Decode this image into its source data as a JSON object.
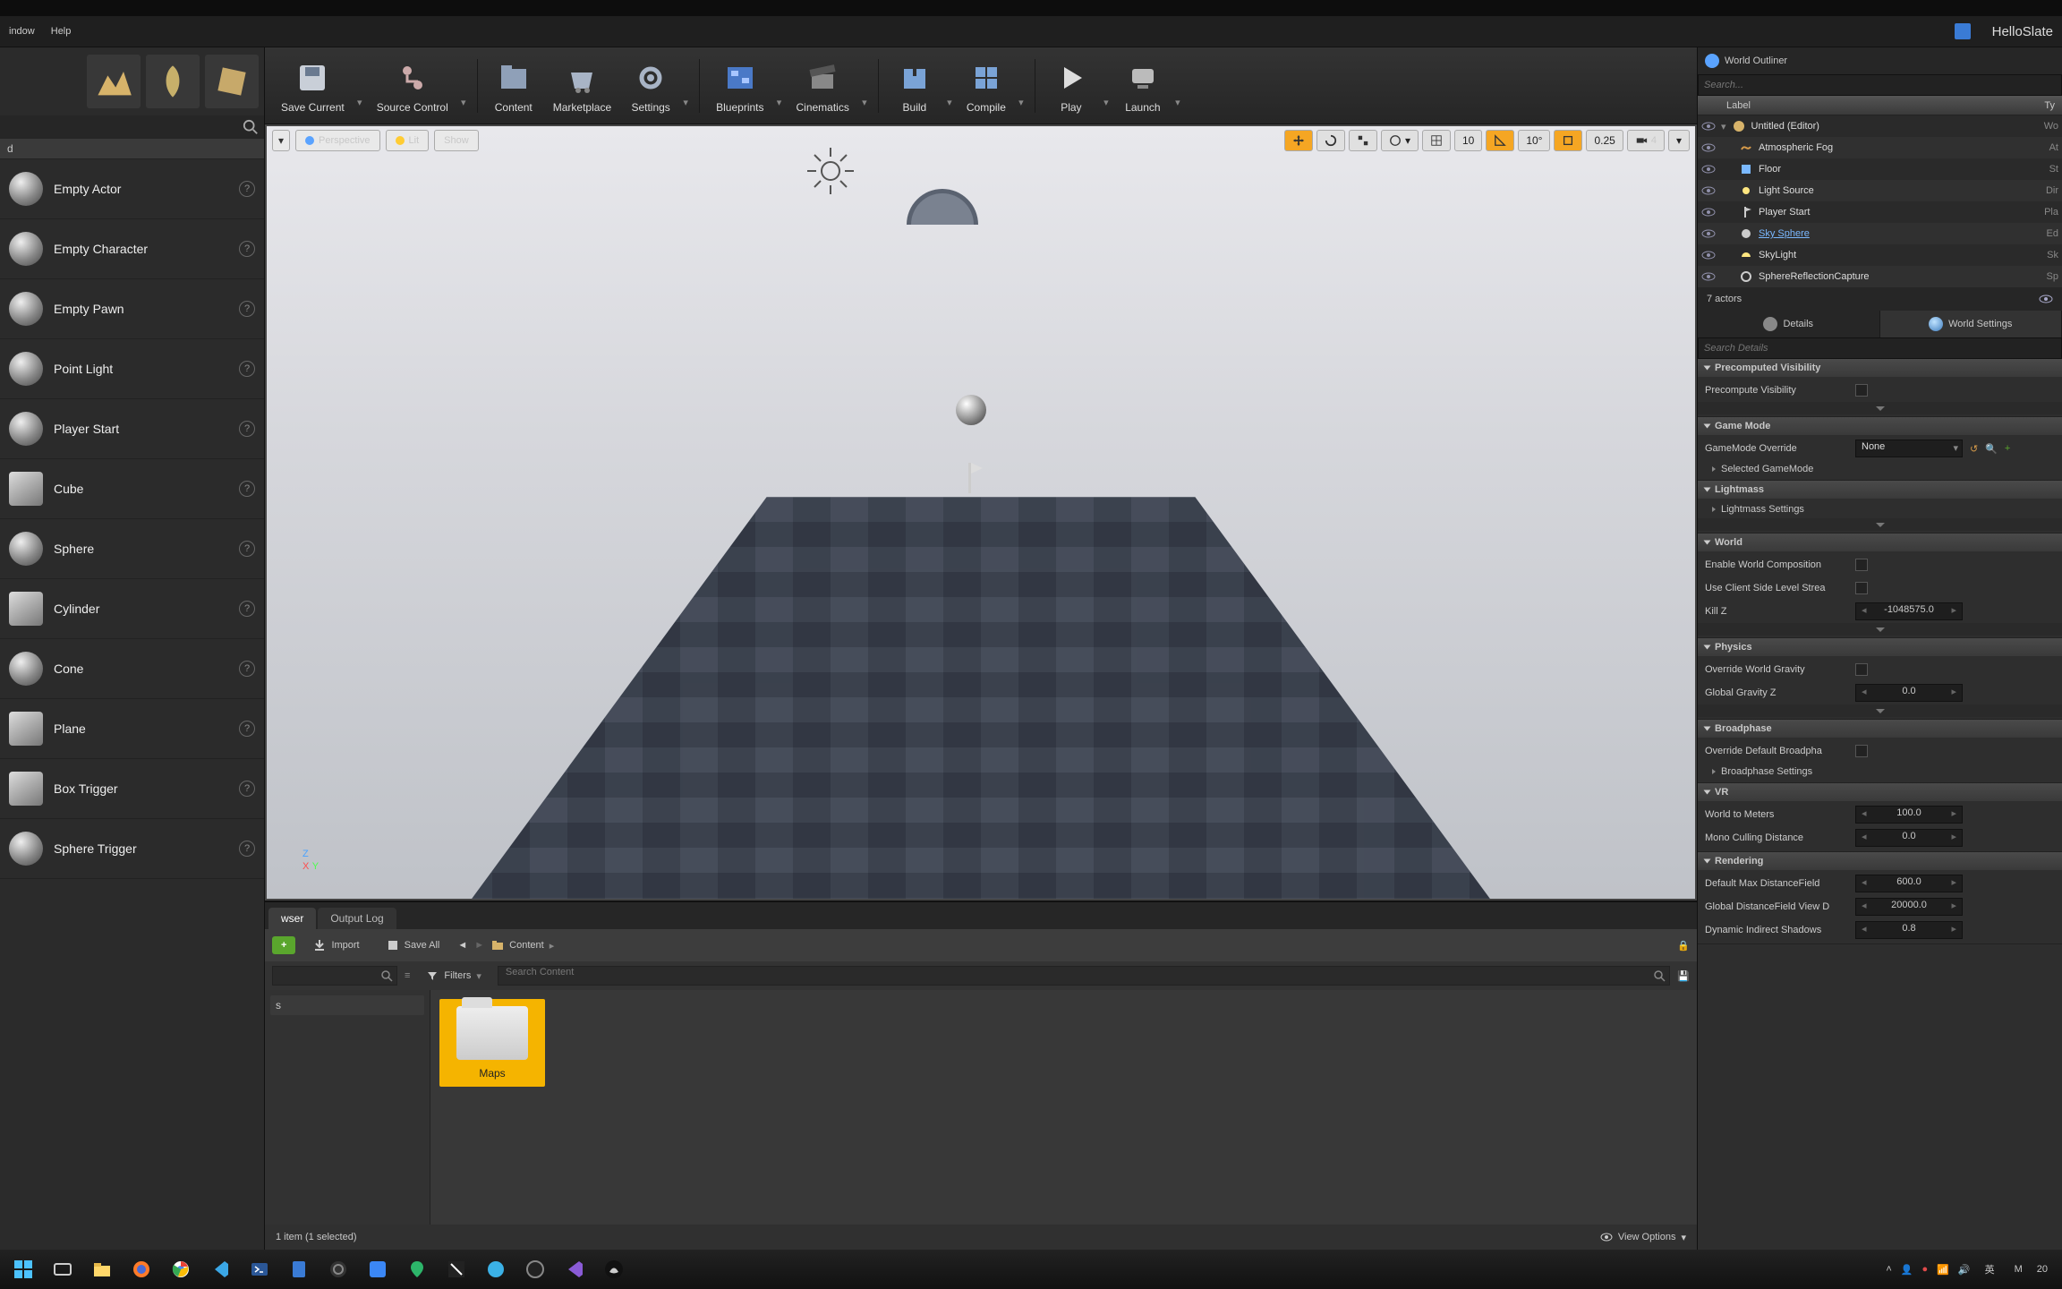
{
  "menubar": {
    "items": [
      "indow",
      "Help"
    ],
    "project_name": "HelloSlate"
  },
  "toolbar": {
    "save_current": "Save Current",
    "source_control": "Source Control",
    "content": "Content",
    "marketplace": "Marketplace",
    "settings": "Settings",
    "blueprints": "Blueprints",
    "cinematics": "Cinematics",
    "build": "Build",
    "compile": "Compile",
    "play": "Play",
    "launch": "Launch"
  },
  "place_actors": {
    "tab": "d",
    "items": [
      {
        "name": "Empty Actor"
      },
      {
        "name": "Empty Character"
      },
      {
        "name": "Empty Pawn"
      },
      {
        "name": "Point Light"
      },
      {
        "name": "Player Start"
      },
      {
        "name": "Cube"
      },
      {
        "name": "Sphere"
      },
      {
        "name": "Cylinder"
      },
      {
        "name": "Cone"
      },
      {
        "name": "Plane"
      },
      {
        "name": "Box Trigger"
      },
      {
        "name": "Sphere Trigger"
      }
    ]
  },
  "viewport": {
    "menu": "▾",
    "perspective": "Perspective",
    "lit": "Lit",
    "show": "Show",
    "grid_snap": "10",
    "angle_snap": "10°",
    "scale_snap": "0.25",
    "cam_speed": "4"
  },
  "outliner": {
    "title": "World Outliner",
    "search_placeholder": "Search...",
    "col_label": "Label",
    "col_type": "Ty",
    "root": "Untitled (Editor)",
    "root_type": "Wo",
    "rows": [
      {
        "label": "Atmospheric Fog",
        "type": "At"
      },
      {
        "label": "Floor",
        "type": "St"
      },
      {
        "label": "Light Source",
        "type": "Dir"
      },
      {
        "label": "Player Start",
        "type": "Pla"
      },
      {
        "label": "Sky Sphere",
        "type": "Ed",
        "link": true
      },
      {
        "label": "SkyLight",
        "type": "Sk"
      },
      {
        "label": "SphereReflectionCapture",
        "type": "Sp"
      }
    ],
    "footer": "7 actors"
  },
  "details_tabs": {
    "details": "Details",
    "world_settings": "World Settings"
  },
  "details_search_placeholder": "Search Details",
  "world_settings": {
    "precomputed_visibility": {
      "title": "Precomputed Visibility",
      "precompute_label": "Precompute Visibility"
    },
    "game_mode": {
      "title": "Game Mode",
      "override_label": "GameMode Override",
      "override_value": "None",
      "selected_label": "Selected GameMode"
    },
    "lightmass": {
      "title": "Lightmass",
      "settings_label": "Lightmass Settings"
    },
    "world": {
      "title": "World",
      "enable_comp": "Enable World Composition",
      "client_stream": "Use Client Side Level Strea",
      "kill_z_label": "Kill Z",
      "kill_z_value": "-1048575.0"
    },
    "physics": {
      "title": "Physics",
      "override_gravity": "Override World Gravity",
      "global_gravity_label": "Global Gravity Z",
      "global_gravity_value": "0.0"
    },
    "broadphase": {
      "title": "Broadphase",
      "override_label": "Override Default Broadpha",
      "settings_label": "Broadphase Settings"
    },
    "vr": {
      "title": "VR",
      "world_to_meters_label": "World to Meters",
      "world_to_meters_value": "100.0",
      "mono_cull_label": "Mono Culling Distance",
      "mono_cull_value": "0.0"
    },
    "rendering": {
      "title": "Rendering",
      "default_max_df_label": "Default Max DistanceField",
      "default_max_df_value": "600.0",
      "global_df_label": "Global DistanceField View D",
      "global_df_value": "20000.0",
      "dyn_indirect_label": "Dynamic Indirect Shadows",
      "dyn_indirect_value": "0.8"
    }
  },
  "content_browser": {
    "tabs": {
      "browser": "wser",
      "output_log": "Output Log"
    },
    "add_new": "",
    "import": "Import",
    "save_all": "Save All",
    "path_root": "Content",
    "filters": "Filters",
    "search_placeholder": "Search Content",
    "tree_root": "s",
    "folders": [
      {
        "name": "Maps"
      }
    ],
    "status": "1 item (1 selected)",
    "view_options": "View Options"
  },
  "taskbar": {
    "lang1": "英",
    "lang2": "M",
    "time": "20"
  }
}
